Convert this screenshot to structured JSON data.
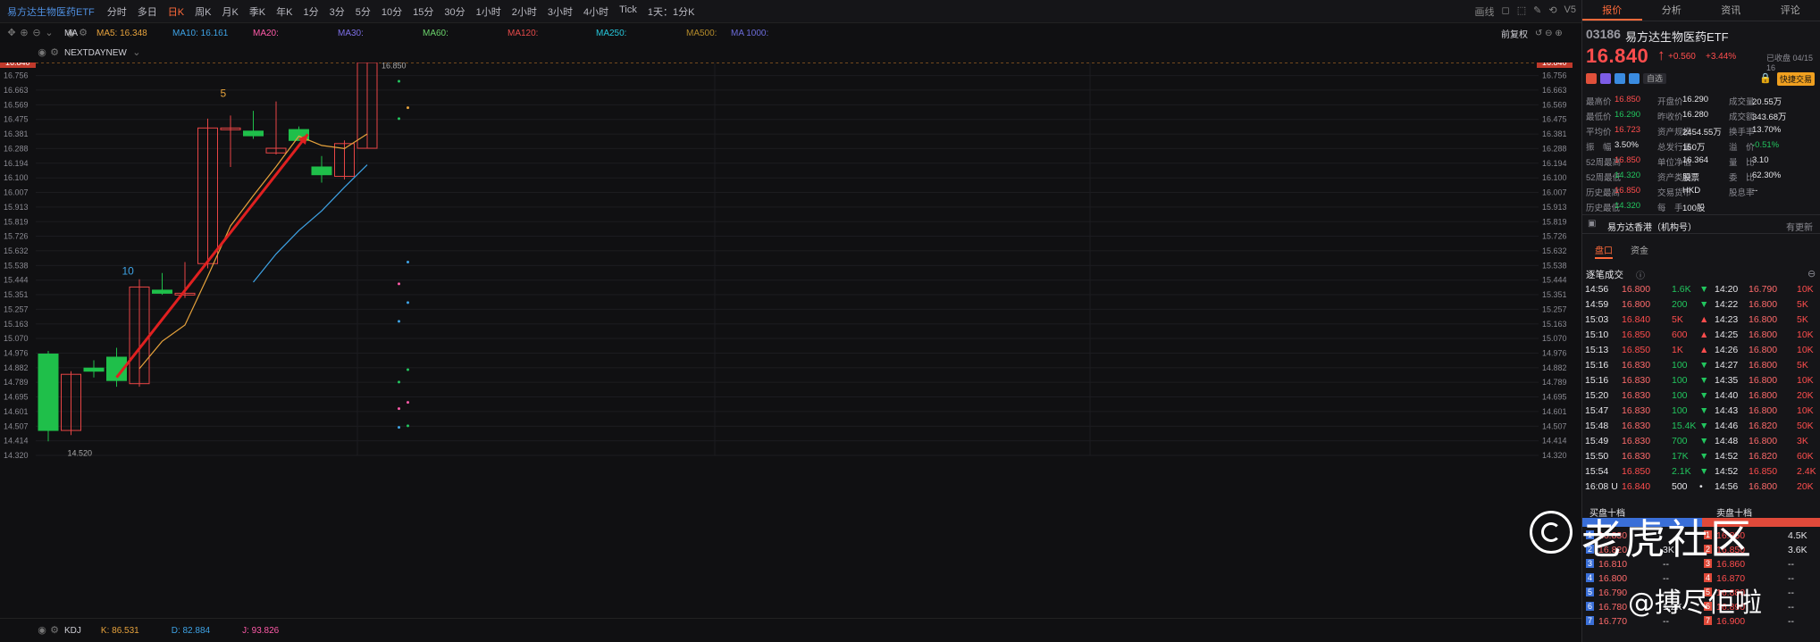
{
  "toolbar": {
    "symbol": "易方达生物医药ETF",
    "periods": [
      "分时",
      "多日",
      "日K",
      "周K",
      "月K",
      "季K",
      "年K",
      "1分",
      "3分",
      "5分",
      "10分",
      "15分",
      "30分",
      "1小时",
      "2小时",
      "3小时",
      "4小时",
      "Tick",
      "1天：1分K"
    ],
    "active_period": "日K",
    "right_items": [
      "画线",
      "◻",
      "⬚",
      "✎",
      "⟲",
      "V5"
    ]
  },
  "indicators": {
    "ma_label": "MA",
    "ma5": "MA5: 16.348",
    "ma10": "MA10: 16.161",
    "ma20": "MA20:",
    "ma30": "MA30:",
    "ma60": "MA60:",
    "ma120": "MA120:",
    "ma250": "MA250:",
    "ma500": "MA500:",
    "ma1000": "MA 1000:",
    "nextday": "NEXTDAYNEW",
    "adjust": "前复权"
  },
  "colors": {
    "ma5": "#e6a23c",
    "ma10": "#3ea3e6",
    "ma20": "#ff5aa8",
    "ma30": "#7d6fe6",
    "ma60": "#6bd36b",
    "ma120": "#e64a4a",
    "ma250": "#26c6da",
    "ma500": "#b38a2a",
    "ma1000": "#6b6bd9",
    "up": "#e84545",
    "down": "#1fbf4a"
  },
  "y_axis": [
    "16.756",
    "16.663",
    "16.569",
    "16.475",
    "16.381",
    "16.288",
    "16.194",
    "16.100",
    "16.007",
    "15.913",
    "15.819",
    "15.726",
    "15.632",
    "15.538",
    "15.444",
    "15.351",
    "15.257",
    "15.163",
    "15.070",
    "14.976",
    "14.882",
    "14.789",
    "14.695",
    "14.601",
    "14.507",
    "14.414",
    "14.320"
  ],
  "price_tags": {
    "current": "16.840",
    "max": "16.850",
    "min": "14.520"
  },
  "annotations": {
    "count_a": "5",
    "count_b": "10"
  },
  "chart_data": {
    "type": "candlestick",
    "ylim": [
      14.32,
      16.84
    ],
    "series": [
      {
        "open": 14.97,
        "close": 14.48,
        "high": 14.99,
        "low": 14.41
      },
      {
        "open": 14.48,
        "close": 14.84,
        "high": 14.86,
        "low": 14.45
      },
      {
        "open": 14.88,
        "close": 14.86,
        "high": 14.93,
        "low": 14.82
      },
      {
        "open": 14.95,
        "close": 14.8,
        "high": 15.01,
        "low": 14.76
      },
      {
        "open": 14.78,
        "close": 15.4,
        "high": 15.45,
        "low": 14.76
      },
      {
        "open": 15.38,
        "close": 15.36,
        "high": 15.49,
        "low": 15.35
      },
      {
        "open": 15.35,
        "close": 15.36,
        "high": 15.56,
        "low": 15.33
      },
      {
        "open": 15.55,
        "close": 16.42,
        "high": 16.48,
        "low": 15.52
      },
      {
        "open": 16.42,
        "close": 16.42,
        "high": 16.5,
        "low": 16.17
      },
      {
        "open": 16.4,
        "close": 16.37,
        "high": 16.53,
        "low": 16.35
      },
      {
        "open": 16.26,
        "close": 16.29,
        "high": 16.59,
        "low": 16.25
      },
      {
        "open": 16.41,
        "close": 16.34,
        "high": 16.43,
        "low": 16.34
      },
      {
        "open": 16.17,
        "close": 16.12,
        "high": 16.24,
        "low": 16.07
      },
      {
        "open": 16.11,
        "close": 16.32,
        "high": 16.34,
        "low": 16.09
      },
      {
        "open": 16.29,
        "close": 16.84,
        "high": 16.85,
        "low": 16.29
      }
    ]
  },
  "kdj": {
    "label": "KDJ",
    "k": "K: 86.531",
    "d": "D: 82.884",
    "j": "J: 93.826"
  },
  "quote": {
    "tabs": [
      "报价",
      "分析",
      "资讯",
      "评论"
    ],
    "code": "03186",
    "name": "易方达生物医药ETF",
    "price": "16.840",
    "arrow": "↑",
    "change": "+0.560",
    "pct": "+3.44%",
    "time": "已收盘 04/15 16",
    "tag": "自选",
    "quick": "快捷交易"
  },
  "stats": [
    [
      "最高价",
      "16.850",
      "开盘价",
      "16.290",
      "成交量",
      "20.55万"
    ],
    [
      "最低价",
      "16.290",
      "昨收价",
      "16.280",
      "成交额",
      "343.68万"
    ],
    [
      "平均价",
      "16.723",
      "资产规模",
      "2454.55万",
      "换手率",
      "13.70%"
    ],
    [
      "振　幅",
      "3.50%",
      "总发行量",
      "150万",
      "溢　价",
      "-0.51%"
    ],
    [
      "52周最高",
      "16.850",
      "单位净值",
      "16.364",
      "量　比",
      "3.10"
    ],
    [
      "52周最低",
      "14.320",
      "资产类别",
      "股票",
      "委　比",
      "62.30%"
    ],
    [
      "历史最高",
      "16.850",
      "交易货币",
      "HKD",
      "股息率",
      "--"
    ],
    [
      "历史最低",
      "14.320",
      "每　手",
      "100股",
      "",
      ""
    ]
  ],
  "fund": {
    "name": "易方达香港（机构号）",
    "more": "有更新"
  },
  "subtabs": [
    "盘口",
    "资金"
  ],
  "trades_title": "逐笔成交",
  "trades": [
    [
      "14:56",
      "16.800",
      "1.6K",
      "▼",
      "14:20",
      "16.790",
      "10K"
    ],
    [
      "14:59",
      "16.800",
      "200",
      "▼",
      "14:22",
      "16.800",
      "5K"
    ],
    [
      "15:03",
      "16.840",
      "5K",
      "▲",
      "14:23",
      "16.800",
      "5K"
    ],
    [
      "15:10",
      "16.850",
      "600",
      "▲",
      "14:25",
      "16.800",
      "10K"
    ],
    [
      "15:13",
      "16.850",
      "1K",
      "▲",
      "14:26",
      "16.800",
      "10K"
    ],
    [
      "15:16",
      "16.830",
      "100",
      "▼",
      "14:27",
      "16.800",
      "5K"
    ],
    [
      "15:16",
      "16.830",
      "100",
      "▼",
      "14:35",
      "16.800",
      "10K"
    ],
    [
      "15:20",
      "16.830",
      "100",
      "▼",
      "14:40",
      "16.800",
      "20K"
    ],
    [
      "15:47",
      "16.830",
      "100",
      "▼",
      "14:43",
      "16.800",
      "10K"
    ],
    [
      "15:48",
      "16.830",
      "15.4K",
      "▼",
      "14:46",
      "16.820",
      "50K"
    ],
    [
      "15:49",
      "16.830",
      "700",
      "▼",
      "14:48",
      "16.800",
      "3K"
    ],
    [
      "15:50",
      "16.830",
      "17K",
      "▼",
      "14:52",
      "16.820",
      "60K"
    ],
    [
      "15:54",
      "16.850",
      "2.1K",
      "▼",
      "14:52",
      "16.850",
      "2.4K"
    ],
    [
      "16:08 U",
      "16.840",
      "500",
      "•",
      "14:56",
      "16.800",
      "20K"
    ]
  ],
  "book_title_bid": "买盘十档",
  "book_title_ask": "卖盘十档",
  "book": [
    [
      "1",
      "16.830",
      "",
      "1",
      "16.850",
      "4.5K"
    ],
    [
      "2",
      "16.820",
      "3K",
      "2",
      "16.850",
      "3.6K"
    ],
    [
      "3",
      "16.810",
      "--",
      "3",
      "16.860",
      "--"
    ],
    [
      "4",
      "16.800",
      "--",
      "4",
      "16.870",
      "--"
    ],
    [
      "5",
      "16.790",
      "--",
      "5",
      "16.880",
      "--"
    ],
    [
      "6",
      "16.780",
      "1.2K",
      "6",
      "16.890",
      "--"
    ],
    [
      "7",
      "16.770",
      "--",
      "7",
      "16.900",
      "--"
    ]
  ],
  "watermark": {
    "brand": "老虎社区",
    "user": "@搏尽佢啦"
  }
}
